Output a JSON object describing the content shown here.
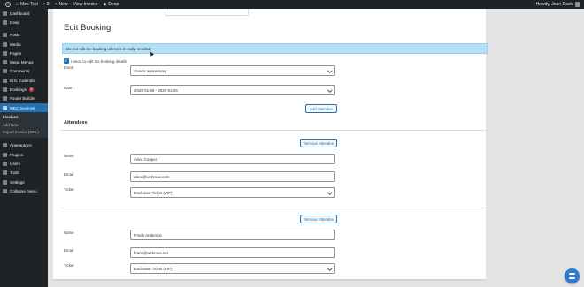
{
  "admin_bar": {
    "site_name": "Mec Test",
    "comments_count": "0",
    "new_label": "New",
    "view_invoice_label": "View Invoice",
    "deep_label": "Deep",
    "howdy": "Howdy, Jean Davis"
  },
  "sidebar": {
    "items": [
      {
        "label": "Dashboard",
        "icon": "dashboard-icon"
      },
      {
        "label": "Deep",
        "icon": "deep-icon"
      },
      {
        "label": "Posts",
        "icon": "pin-icon"
      },
      {
        "label": "Media",
        "icon": "media-icon"
      },
      {
        "label": "Pages",
        "icon": "pages-icon"
      },
      {
        "label": "Mega Menus",
        "icon": "menu-icon"
      },
      {
        "label": "Comments",
        "icon": "comment-icon"
      },
      {
        "label": "M.E. Calendar",
        "icon": "calendar-icon"
      },
      {
        "label": "Bookings",
        "icon": "booking-icon",
        "badge": "2"
      },
      {
        "label": "Footer Builder",
        "icon": "footer-icon"
      },
      {
        "label": "MEC Invoices",
        "icon": "invoice-icon",
        "current": true
      }
    ],
    "submenu": [
      "Invoices",
      "Add New",
      "Export Invoice (XML)"
    ],
    "items_after": [
      {
        "label": "Appearance",
        "icon": "brush-icon"
      },
      {
        "label": "Plugins",
        "icon": "plugin-icon"
      },
      {
        "label": "Users",
        "icon": "users-icon"
      },
      {
        "label": "Tools",
        "icon": "tools-icon"
      },
      {
        "label": "Settings",
        "icon": "settings-icon"
      },
      {
        "label": "Collapse menu",
        "icon": "collapse-icon"
      }
    ]
  },
  "page": {
    "title": "Edit Booking",
    "notice": "Do not edit the booking unless it is really needed!",
    "checkbox_label": "I need to edit the booking details",
    "event_label": "Event",
    "event_value": "Jane's anniversary",
    "date_label": "Date",
    "date_value": "2020-01-26 - 2020-01-26",
    "add_attendee": "Add Attendee",
    "attendees_heading": "Attendees",
    "remove_attendee": "Remove Attendee",
    "name_label": "Name",
    "email_label": "Email",
    "ticket_label": "Ticket",
    "attendees": [
      {
        "name": "Alice Cooper",
        "email": "alice@webmus.com",
        "ticket": "Exclusive Ticket (VIP)"
      },
      {
        "name": "Frank Anderson",
        "email": "frank@webmus.net",
        "ticket": "Exclusive Ticket (VIP)"
      }
    ]
  },
  "colors": {
    "admin_dark": "#1d2327",
    "accent_blue": "#2271b1",
    "notice_blue": "#b3e1f7",
    "fab_blue": "#2f7ad4"
  }
}
